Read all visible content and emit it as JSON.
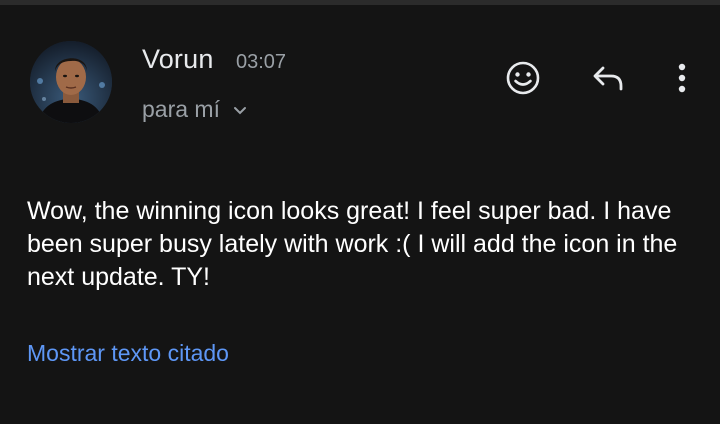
{
  "message": {
    "sender_name": "Vorun",
    "timestamp": "03:07",
    "recipient_label": "para mí",
    "body": "Wow, the winning icon looks great! I feel super bad. I have been super busy lately with work :( I will add the icon in the next update. TY!",
    "show_quoted_text": "Mostrar texto citado"
  },
  "actions": {
    "emoji_icon": "smiley-icon",
    "reply_icon": "reply-arrow-icon",
    "more_icon": "more-vert-icon"
  },
  "colors": {
    "background": "#141414",
    "secondary_text": "#9aa0a6",
    "link": "#5e97f6"
  }
}
